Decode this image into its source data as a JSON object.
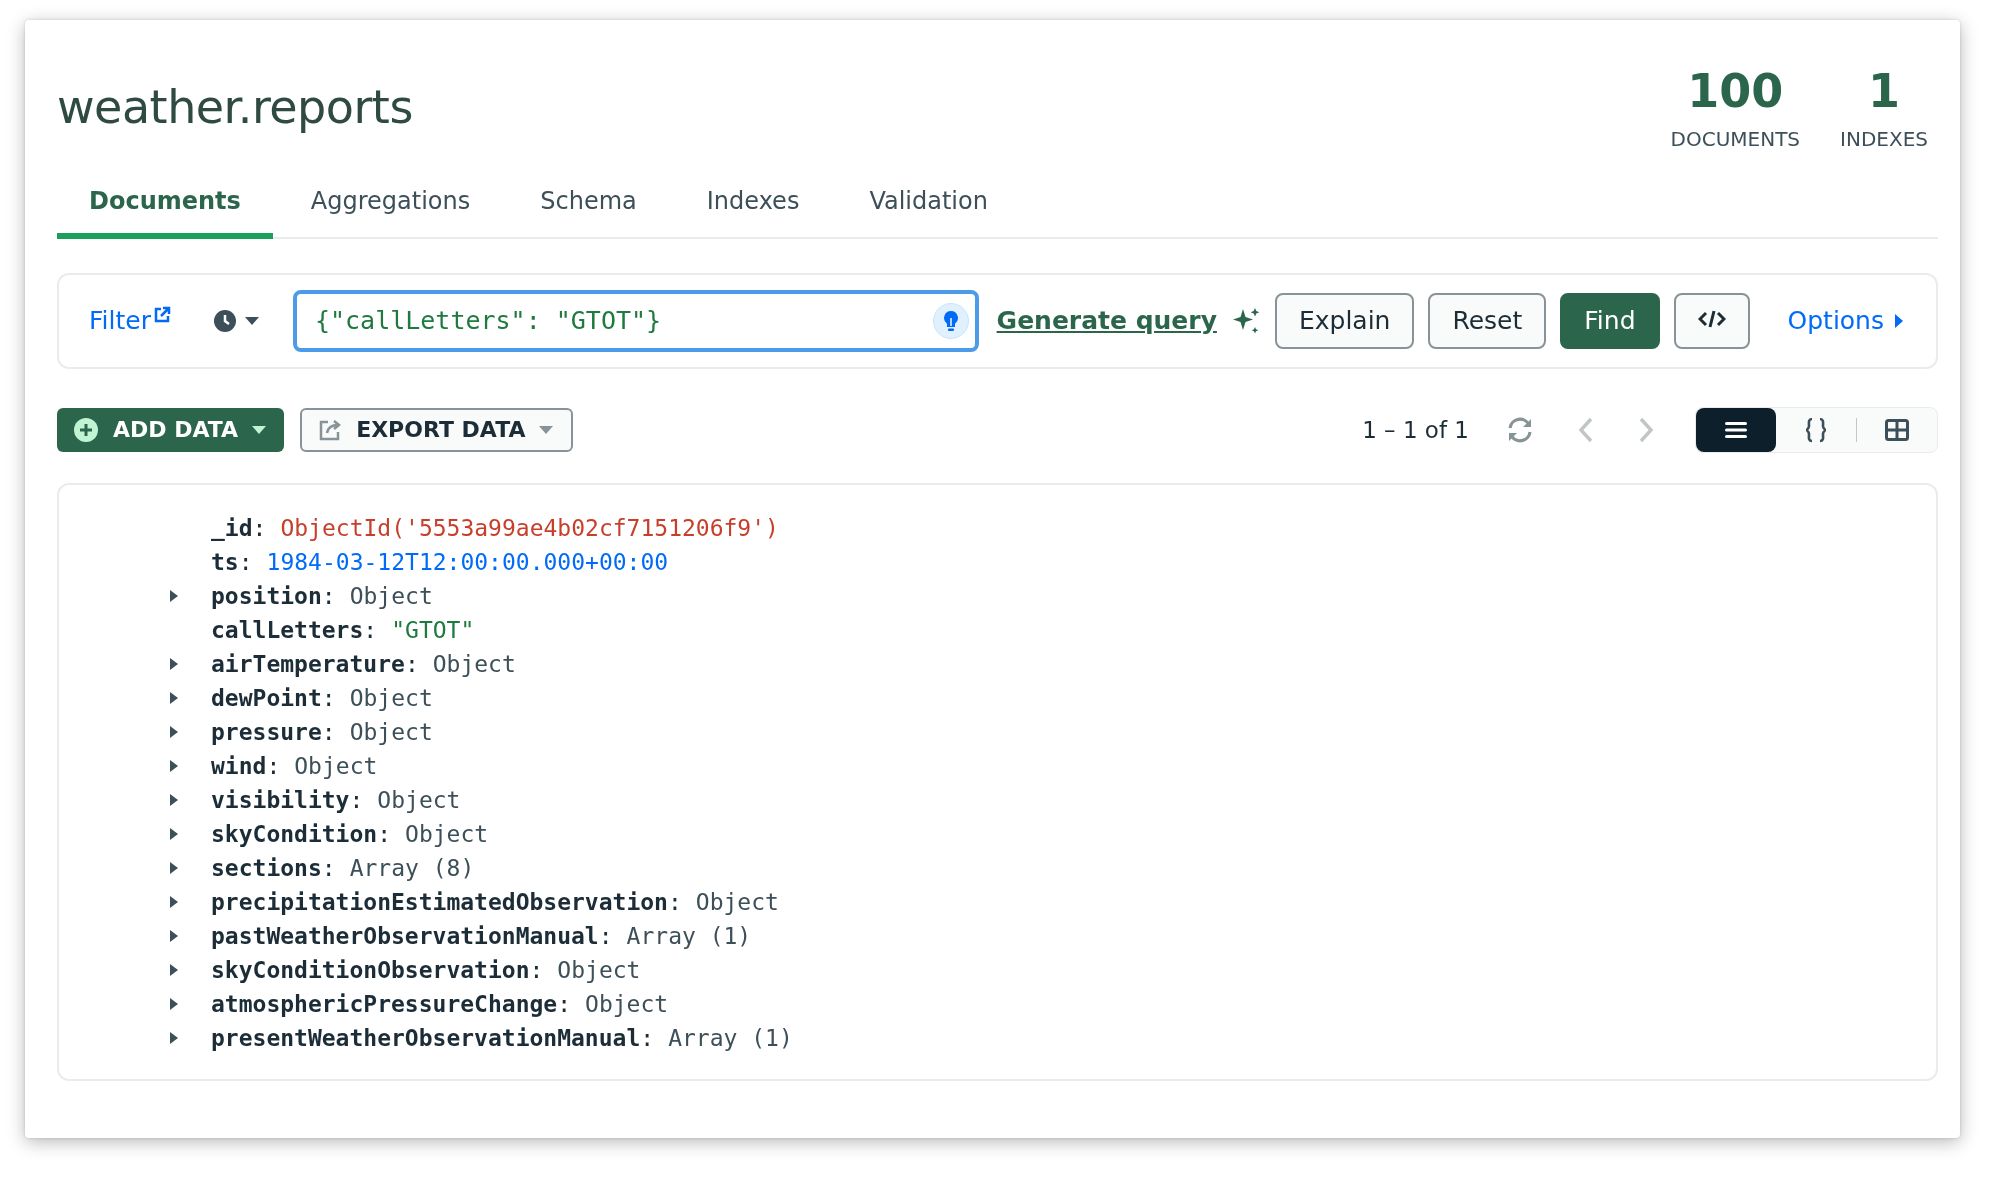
{
  "collection": {
    "title": "weather.reports"
  },
  "stats": [
    {
      "value": "100",
      "label": "DOCUMENTS"
    },
    {
      "value": "1",
      "label": "INDEXES"
    }
  ],
  "tabs": [
    {
      "label": "Documents",
      "selected": true
    },
    {
      "label": "Aggregations",
      "selected": false
    },
    {
      "label": "Schema",
      "selected": false
    },
    {
      "label": "Indexes",
      "selected": false
    },
    {
      "label": "Validation",
      "selected": false
    }
  ],
  "query_bar": {
    "filter_label": "Filter",
    "filter_value": "{\"callLetters\": \"GTOT\"}",
    "focused": true,
    "generate_query": "Generate query",
    "buttons": [
      {
        "label": "Explain",
        "kind": "secondary"
      },
      {
        "label": "Reset",
        "kind": "secondary"
      },
      {
        "label": "Find",
        "kind": "primary"
      }
    ],
    "options": "Options"
  },
  "toolbar": {
    "add_data": "ADD DATA",
    "export_data": "EXPORT DATA",
    "pagination": "1 – 1 of 1",
    "views": [
      {
        "kind": "list",
        "selected": true
      },
      {
        "kind": "json",
        "selected": false
      },
      {
        "kind": "table",
        "selected": false
      }
    ]
  },
  "document": [
    {
      "key": "**_id**:",
      "value": "ObjectId('5553a99ae4b02cf7151206f9')",
      "kind": "objectid",
      "expandable": false
    },
    {
      "key": "**ts**:",
      "value": "1984-03-12T12:00:00.000+00:00",
      "kind": "date",
      "expandable": false
    },
    {
      "key": "**position**:",
      "value": "Object",
      "kind": "object",
      "expandable": true
    },
    {
      "key": "**callLetters**:",
      "value": "\"GTOT\"",
      "kind": "string",
      "expandable": false
    },
    {
      "key": "**airTemperature**:",
      "value": "Object",
      "kind": "object",
      "expandable": true
    },
    {
      "key": "**dewPoint**:",
      "value": "Object",
      "kind": "object",
      "expandable": true
    },
    {
      "key": "**pressure**:",
      "value": "Object",
      "kind": "object",
      "expandable": true
    },
    {
      "key": "**wind**:",
      "value": "Object",
      "kind": "object",
      "expandable": true
    },
    {
      "key": "**visibility**:",
      "value": "Object",
      "kind": "object",
      "expandable": true
    },
    {
      "key": "**skyCondition**:",
      "value": "Object",
      "kind": "object",
      "expandable": true
    },
    {
      "key": "**sections**:",
      "value": "Array (8)",
      "kind": "array",
      "expandable": true
    },
    {
      "key": "**precipitationEstimatedObservation**:",
      "value": "Object",
      "kind": "object",
      "expandable": true
    },
    {
      "key": "**pastWeatherObservationManual**:",
      "value": "Array (1)",
      "kind": "array",
      "expandable": true
    },
    {
      "key": "**skyConditionObservation**:",
      "value": "Object",
      "kind": "object",
      "expandable": true
    },
    {
      "key": "**atmosphericPressureChange**:",
      "value": "Object",
      "kind": "object",
      "expandable": true
    },
    {
      "key": "**presentWeatherObservationManual**:",
      "value": "Array (1)",
      "kind": "array",
      "expandable": true
    }
  ]
}
